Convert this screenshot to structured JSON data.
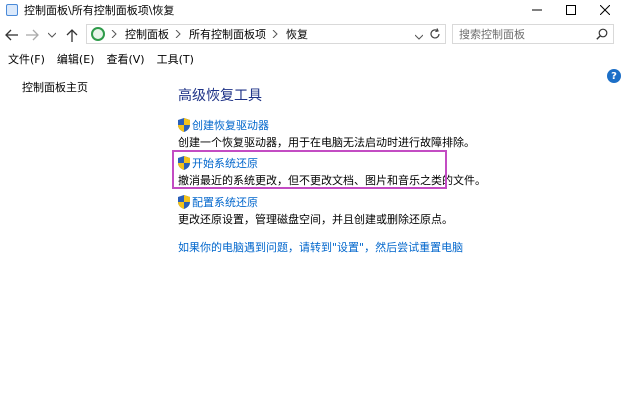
{
  "window": {
    "title": "控制面板\\所有控制面板项\\恢复"
  },
  "address": {
    "crumbs": [
      "控制面板",
      "所有控制面板项",
      "恢复"
    ]
  },
  "search": {
    "placeholder": "搜索控制面板"
  },
  "menu": {
    "items": [
      "文件(F)",
      "编辑(E)",
      "查看(V)",
      "工具(T)"
    ]
  },
  "sidebar": {
    "home_link": "控制面板主页"
  },
  "main": {
    "heading": "高级恢复工具",
    "tools": [
      {
        "link": "创建恢复驱动器",
        "desc": "创建一个恢复驱动器，用于在电脑无法启动时进行故障排除。"
      },
      {
        "link": "开始系统还原",
        "desc": "撤消最近的系统更改，但不更改文档、图片和音乐之类的文件。"
      },
      {
        "link": "配置系统还原",
        "desc": "更改还原设置，管理磁盘空间，并且创建或删除还原点。"
      }
    ],
    "reset_link": "如果你的电脑遇到问题，请转到\"设置\"，然后尝试重置电脑"
  },
  "colors": {
    "highlight_border": "#c34cc3",
    "link": "#0066cc",
    "heading": "#1e3287"
  }
}
